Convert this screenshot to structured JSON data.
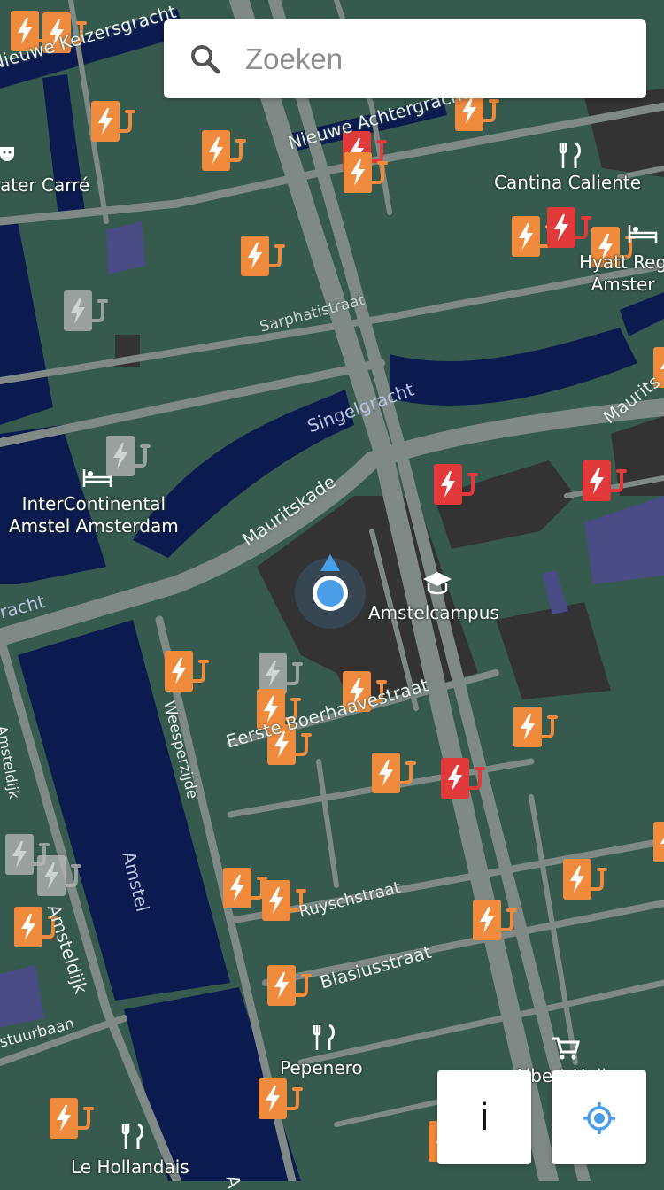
{
  "search": {
    "placeholder": "Zoeken",
    "icon": "search-icon"
  },
  "buttons": {
    "info_label": "i",
    "locate_icon": "crosshair-icon"
  },
  "colors": {
    "land": "#375a4e",
    "water": "#0b1a4f",
    "road": "#7f8a86",
    "building": "#333333",
    "charger_available": "#f08a3c",
    "charger_occupied": "#e23a3a",
    "charger_unknown": "#b9b9b9",
    "user_location": "#4a9ee8"
  },
  "places": [
    {
      "id": "theater-carre",
      "label": "ater Carré",
      "icon": "theater-icon"
    },
    {
      "id": "cantina-caliente",
      "label": "Cantina Caliente",
      "icon": "restaurant-icon"
    },
    {
      "id": "hyatt-regency",
      "label": "Hyatt Reg\nAmster",
      "icon": "hotel-icon"
    },
    {
      "id": "intercontinental",
      "label": "InterContinental\nAmstel Amsterdam",
      "icon": "hotel-icon"
    },
    {
      "id": "amstelcampus",
      "label": "Amstelcampus",
      "icon": "school-icon"
    },
    {
      "id": "pepenero",
      "label": "Pepenero",
      "icon": "restaurant-icon"
    },
    {
      "id": "albert-heijn",
      "label": "Albert Heij",
      "icon": "shopping-cart-icon"
    },
    {
      "id": "le-hollandais",
      "label": "Le Hollandais",
      "icon": "restaurant-icon"
    }
  ],
  "streets": [
    {
      "id": "nieuwe-keizersgracht",
      "label": "Nieuwe Keizersgracht"
    },
    {
      "id": "nieuwe-achtergracht",
      "label": "Nieuwe Achtergracht"
    },
    {
      "id": "sarphatistraat",
      "label": "Sarphatistraat"
    },
    {
      "id": "singelgracht",
      "label": "Singelgracht"
    },
    {
      "id": "mauritskade",
      "label": "Mauritskade"
    },
    {
      "id": "mauritskade-east",
      "label": "Maurits"
    },
    {
      "id": "gracht",
      "label": "racht"
    },
    {
      "id": "weesperzijde",
      "label": "Weesperzijde"
    },
    {
      "id": "eerste-boerhaavestraat",
      "label": "Eerste Boerhaavestraat"
    },
    {
      "id": "amstel",
      "label": "Amstel"
    },
    {
      "id": "amsteldijk",
      "label": "Amsteldijk"
    },
    {
      "id": "amsteldijk-north",
      "label": "Amsteldijk"
    },
    {
      "id": "ruyschstraat",
      "label": "Ruyschstraat"
    },
    {
      "id": "blasiusstraat",
      "label": "Blasiusstraat"
    },
    {
      "id": "stuurbaan",
      "label": "stuurbaan"
    },
    {
      "id": "amstel-south",
      "label": "A"
    }
  ],
  "chargers": [
    {
      "status": "available"
    },
    {
      "status": "available"
    },
    {
      "status": "available"
    },
    {
      "status": "available"
    },
    {
      "status": "available"
    },
    {
      "status": "occupied"
    },
    {
      "status": "available"
    },
    {
      "status": "available"
    },
    {
      "status": "available"
    },
    {
      "status": "occupied"
    },
    {
      "status": "available"
    },
    {
      "status": "unknown"
    },
    {
      "status": "unknown"
    },
    {
      "status": "occupied"
    },
    {
      "status": "occupied"
    },
    {
      "status": "available"
    },
    {
      "status": "available"
    },
    {
      "status": "unknown"
    },
    {
      "status": "available"
    },
    {
      "status": "available"
    },
    {
      "status": "available"
    },
    {
      "status": "available"
    },
    {
      "status": "occupied"
    },
    {
      "status": "available"
    },
    {
      "status": "available"
    },
    {
      "status": "available"
    },
    {
      "status": "available"
    },
    {
      "status": "unknown"
    },
    {
      "status": "unknown"
    },
    {
      "status": "available"
    },
    {
      "status": "available"
    },
    {
      "status": "available"
    },
    {
      "status": "available"
    },
    {
      "status": "available"
    },
    {
      "status": "available"
    },
    {
      "status": "available"
    }
  ]
}
